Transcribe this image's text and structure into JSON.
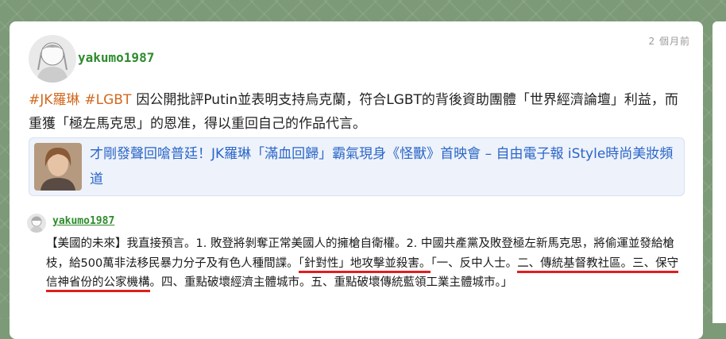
{
  "post": {
    "username": "yakumo1987",
    "timestamp": "2 個月前",
    "tags": [
      "#JK羅琳",
      "#LGBT"
    ],
    "text": "因公開批評Putin並表明支持烏克蘭，符合LGBT的背後資助團體「世界經濟論壇」利益，而重獲「極左馬克思」的恩准，得以重回自己的作品代言。"
  },
  "link_preview": {
    "title": "才剛發聲回嗆普廷！JK羅琳「滿血回歸」霸氣現身《怪獸》首映會 – 自由電子報 iStyle時尚美妝頻道"
  },
  "reply": {
    "username": "yakumo1987",
    "text_part1": "【美國的未來】我直接預言。1. 敗登將剝奪正常美國人的擁槍自衛權。2. 中國共產黨及敗登極左新馬克思，將偷運並發給槍枝，給500萬非法移民暴力分子及有色人種間諜。",
    "text_underline1": "「針對性」地攻擊並殺害。",
    "text_part2": "「一、反中人士。",
    "text_underline2": "二、傳統基督教社區。三、保守信神省份的公家機構",
    "text_part3": "。四、重點破壞經濟主體城市。五、重點破壞傳統藍領工業主體城市。」"
  }
}
